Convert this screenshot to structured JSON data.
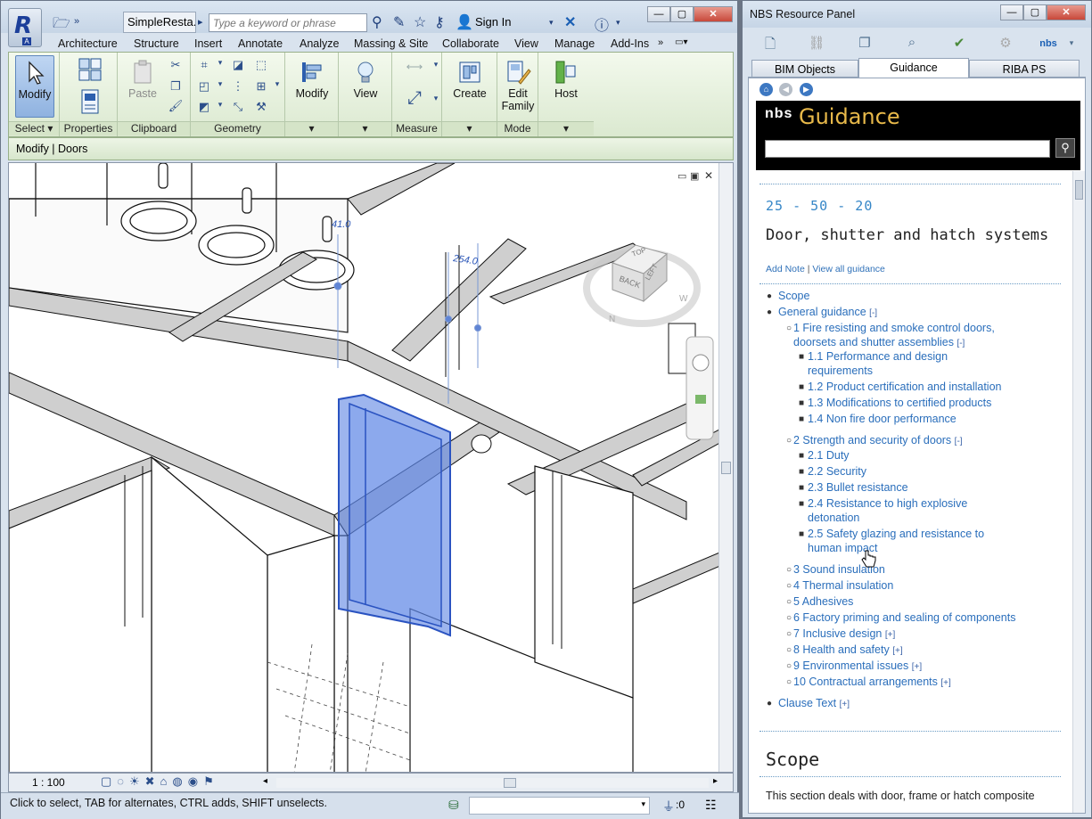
{
  "revit": {
    "app_letter": "R",
    "app_sub": "A",
    "doc_title": "SimpleResta...",
    "search_placeholder": "Type a keyword or phrase",
    "signin": "Sign In",
    "menu": [
      "Architecture",
      "Structure",
      "Insert",
      "Annotate",
      "Analyze",
      "Massing & Site",
      "Collaborate",
      "View",
      "Manage",
      "Add-Ins"
    ],
    "ribbon": {
      "modify": "Modify",
      "select": "Select",
      "properties": "Properties",
      "paste": "Paste",
      "clipboard": "Clipboard",
      "geometry": "Geometry",
      "modify2": "Modify",
      "view": "View",
      "measure": "Measure",
      "create": "Create",
      "edit_family_1": "Edit",
      "edit_family_2": "Family",
      "mode": "Mode",
      "host": "Host"
    },
    "option_bar": "Modify | Doors",
    "dimensions": [
      "41.0",
      "254.0"
    ],
    "viewcube": {
      "top": "TOP",
      "back": "BACK",
      "left": "LEFT",
      "n": "N",
      "w": "W"
    },
    "scale": "1 : 100",
    "status": "Click to select, TAB for alternates, CTRL adds, SHIFT unselects.",
    "status_count": ":0"
  },
  "nbs": {
    "title": "NBS Resource Panel",
    "toolbar_brand": "nbs",
    "tabs": [
      "BIM Objects",
      "Guidance",
      "RIBA PS"
    ],
    "active_tab": 1,
    "banner_logo": "nbs",
    "banner_word": "Guidance",
    "breadcrumb": "25 - 50 - 20",
    "heading": "Door, shutter and hatch systems",
    "add_note": "Add Note",
    "link_sep": "|",
    "view_all": "View all guidance",
    "toc": [
      {
        "lvl": 0,
        "text": "Scope"
      },
      {
        "lvl": 0,
        "text": "General guidance",
        "tog": "[-]"
      },
      {
        "lvl": 1,
        "text": "1 Fire resisting and smoke control doors,",
        "text2": "doorsets and shutter assemblies",
        "tog": "[-]"
      },
      {
        "lvl": 2,
        "text": "1.1 Performance and design",
        "text2": "requirements"
      },
      {
        "lvl": 2,
        "text": "1.2 Product certification and installation"
      },
      {
        "lvl": 2,
        "text": "1.3 Modifications to certified products"
      },
      {
        "lvl": 2,
        "text": "1.4 Non fire door performance"
      },
      {
        "lvl": 1,
        "text": "2 Strength and security of doors",
        "tog": "[-]"
      },
      {
        "lvl": 2,
        "text": "2.1 Duty"
      },
      {
        "lvl": 2,
        "text": "2.2 Security"
      },
      {
        "lvl": 2,
        "text": "2.3 Bullet resistance"
      },
      {
        "lvl": 2,
        "text": "2.4 Resistance to high explosive",
        "text2": "detonation"
      },
      {
        "lvl": 2,
        "text": "2.5 Safety glazing and resistance to",
        "text2": "human impact"
      },
      {
        "lvl": 1,
        "text": "3 Sound insulation"
      },
      {
        "lvl": 1,
        "text": "4 Thermal insulation"
      },
      {
        "lvl": 1,
        "text": "5 Adhesives"
      },
      {
        "lvl": 1,
        "text": "6 Factory priming and sealing of components"
      },
      {
        "lvl": 1,
        "text": "7 Inclusive design",
        "tog": "[+]"
      },
      {
        "lvl": 1,
        "text": "8 Health and safety",
        "tog": "[+]"
      },
      {
        "lvl": 1,
        "text": "9 Environmental issues",
        "tog": "[+]"
      },
      {
        "lvl": 1,
        "text": "10 Contractual arrangements",
        "tog": "[+]"
      },
      {
        "lvl": 0,
        "text": "Clause Text",
        "tog": "[+]"
      }
    ],
    "scope_heading": "Scope",
    "scope_text": "This section deals with door, frame or hatch composite"
  }
}
